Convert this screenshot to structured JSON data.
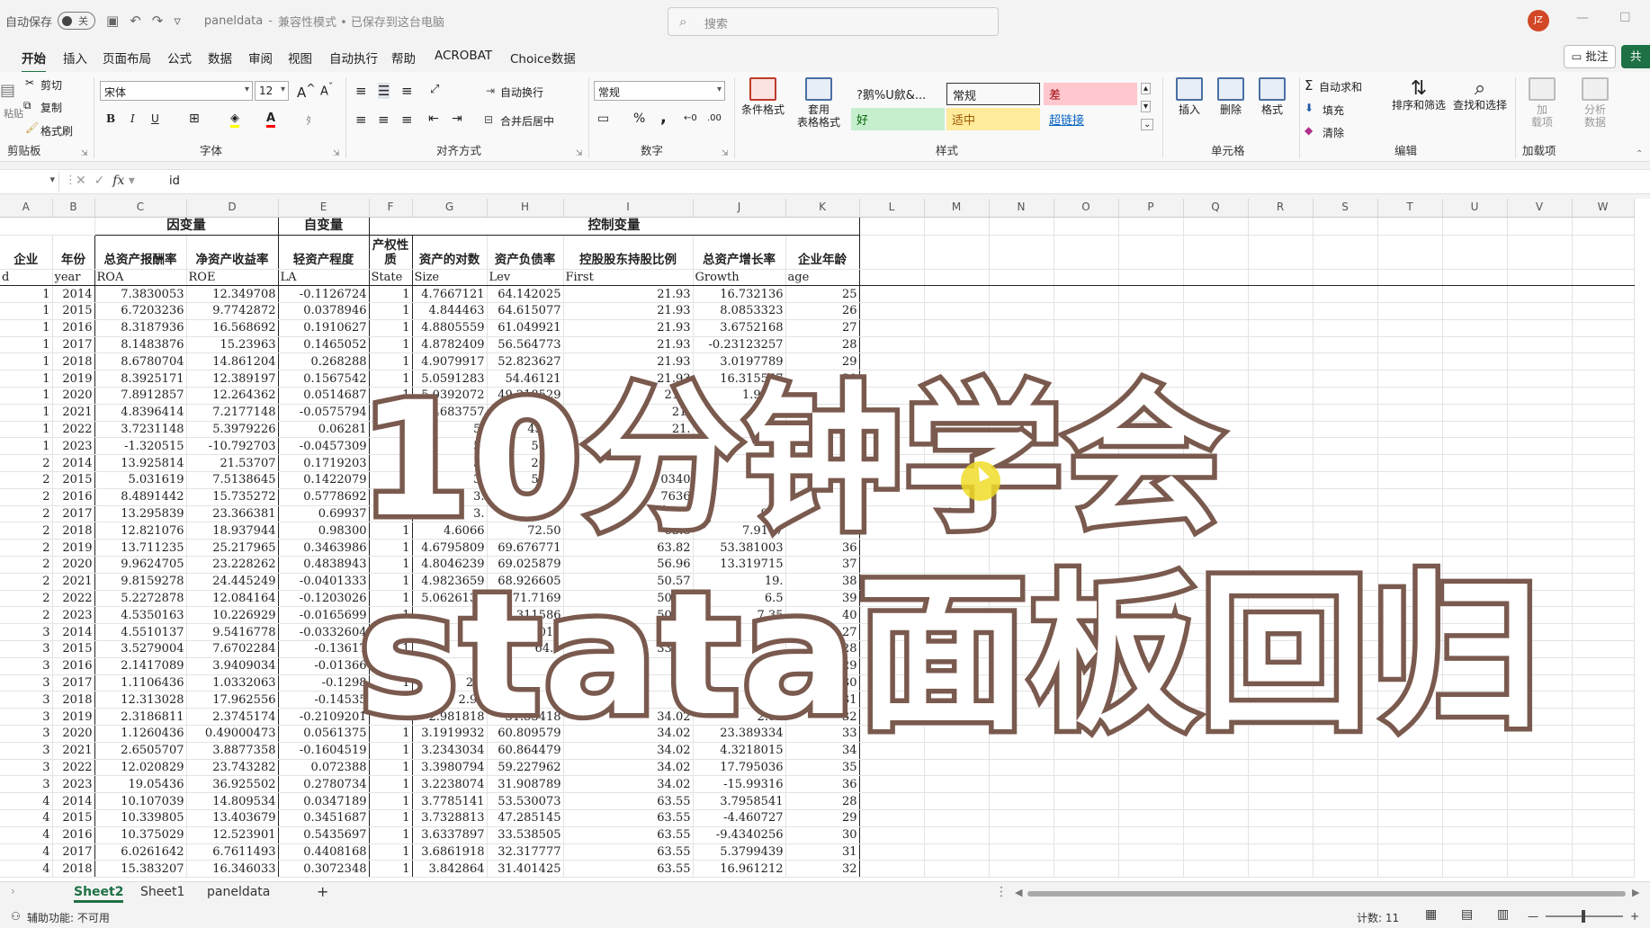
{
  "titlebar": {
    "autosave_label": "自动保存",
    "autosave_state": "关",
    "undo_icon": "undo-icon",
    "redo_icon": "redo-icon",
    "filename": "paneldata",
    "status": "兼容性模式 • 已保存到这台电脑",
    "search_placeholder": "搜索",
    "user_initials": "JZ"
  },
  "menu": {
    "tabs": [
      "开始",
      "插入",
      "页面布局",
      "公式",
      "数据",
      "审阅",
      "视图",
      "自动执行",
      "帮助",
      "ACROBAT",
      "Choice数据"
    ],
    "active": "开始",
    "comment_button": "批注",
    "share_button": "共"
  },
  "ribbon": {
    "clipboard": {
      "group": "剪贴板",
      "paste": "粘贴",
      "cut": "剪切",
      "copy": "复制",
      "format_painter": "格式刷"
    },
    "font": {
      "group": "字体",
      "font_name": "宋体",
      "font_size": "12",
      "bold": "B",
      "italic": "I",
      "underline": "U",
      "font_color": "A"
    },
    "alignment": {
      "group": "对齐方式",
      "wrap_text": "自动换行",
      "merge_center": "合并后居中"
    },
    "number": {
      "group": "数字",
      "format": "常规",
      "percent": "%",
      "comma": ","
    },
    "styles": {
      "group": "样式",
      "conditional_format": "条件格式",
      "table_format": "套用\n表格格式",
      "cells": [
        {
          "label": "?鹅%U歛&...",
          "bg": "#ffffff",
          "color": "#000000"
        },
        {
          "label": "常规",
          "bg": "#ffffff",
          "color": "#000000"
        },
        {
          "label": "差",
          "bg": "#ffc7ce",
          "color": "#9c0006"
        },
        {
          "label": "好",
          "bg": "#c6efce",
          "color": "#006100"
        },
        {
          "label": "适中",
          "bg": "#ffeb9c",
          "color": "#9c5700"
        },
        {
          "label": "超链接",
          "bg": "#ffffff",
          "color": "#0563c1"
        }
      ]
    },
    "cells": {
      "group": "单元格",
      "insert": "插入",
      "delete": "删除",
      "format": "格式"
    },
    "editing": {
      "group": "编辑",
      "autosum": "自动求和",
      "fill": "填充",
      "clear": "清除",
      "sort_filter": "排序和筛选",
      "find_select": "查找和选择"
    },
    "addins": {
      "group": "加载项",
      "addins": "加\n载项",
      "analyze": "分析\n数据"
    }
  },
  "formula_bar": {
    "name_box": "",
    "fx": "fx",
    "content": "id"
  },
  "columns": [
    "A",
    "B",
    "C",
    "D",
    "E",
    "F",
    "G",
    "H",
    "I",
    "J",
    "K",
    "L",
    "M",
    "N",
    "O",
    "P",
    "Q",
    "R",
    "S",
    "T",
    "U",
    "V",
    "W"
  ],
  "sheet": {
    "group_headers": {
      "dependent": "因变量",
      "independent": "自变量",
      "control": "控制变量"
    },
    "headers": [
      "企业",
      "年份",
      "总资产报酬率",
      "净资产收益率",
      "轻资产程度",
      "产权性质",
      "资产的对数",
      "资产负债率",
      "控股股东持股比例",
      "总资产增长率",
      "企业年龄"
    ],
    "var_names": [
      "d",
      "year",
      "ROA",
      "ROE",
      "LA",
      "State",
      "Size",
      "Lev",
      "First",
      "Growth",
      "age"
    ],
    "rows": [
      [
        "1",
        "2014",
        "7.3830053",
        "12.349708",
        "-0.1126724",
        "1",
        "4.7667121",
        "64.142025",
        "21.93",
        "16.732136",
        "25"
      ],
      [
        "1",
        "2015",
        "6.7203236",
        "9.7742872",
        "0.0378946",
        "1",
        "4.844463",
        "64.615077",
        "21.93",
        "8.0853323",
        "26"
      ],
      [
        "1",
        "2016",
        "8.3187936",
        "16.568692",
        "0.1910627",
        "1",
        "4.8805559",
        "61.049921",
        "21.93",
        "3.6752168",
        "27"
      ],
      [
        "1",
        "2017",
        "8.1483876",
        "15.23963",
        "0.1465052",
        "1",
        "4.8782409",
        "56.564773",
        "21.93",
        "-0.23123257",
        "28"
      ],
      [
        "1",
        "2018",
        "8.6780704",
        "14.861204",
        "0.268288",
        "1",
        "4.9079917",
        "52.823627",
        "21.93",
        "3.0197789",
        "29"
      ],
      [
        "1",
        "2019",
        "8.3925171",
        "12.389197",
        "0.1567542",
        "1",
        "5.0591283",
        "54.46121",
        "21.93",
        "16.315557",
        "30"
      ],
      [
        "1",
        "2020",
        "7.8912857",
        "12.264362",
        "0.0514687",
        "1",
        "5.0392072",
        "49.218529",
        "21.9",
        "1.9724",
        "31"
      ],
      [
        "1",
        "2021",
        "4.8396414",
        "7.2177148",
        "-0.0575794",
        "1",
        "5.4683757",
        "45.3219",
        "21.",
        "",
        "32"
      ],
      [
        "1",
        "2022",
        "3.7231148",
        "5.3979226",
        "0.06281",
        "1",
        "5.",
        "43.91",
        "21.",
        "",
        "33"
      ],
      [
        "1",
        "2023",
        "-1.320515",
        "-10.792703",
        "-0.0457309",
        "1",
        "5.",
        "5679",
        "",
        "",
        "34"
      ],
      [
        "2",
        "2014",
        "13.925814",
        "21.53707",
        "0.1719203",
        "1",
        "3.",
        "2673",
        "",
        "",
        "31"
      ],
      [
        "2",
        "2015",
        "5.031619",
        "7.5138645",
        "0.1422079",
        "1",
        "3.",
        "5798",
        "0340",
        "",
        "32"
      ],
      [
        "2",
        "2016",
        "8.4891442",
        "15.735272",
        "0.5778692",
        "1",
        "3.",
        "6568",
        "7636",
        "",
        "33"
      ],
      [
        "2",
        "2017",
        "13.295839",
        "23.366381",
        "0.69937",
        "1",
        "3.",
        "",
        "311",
        "950",
        "34"
      ],
      [
        "2",
        "2018",
        "12.821076",
        "18.937944",
        "0.98300",
        "1",
        "4.6066",
        "72.50",
        "63.8",
        "7.9147",
        "35"
      ],
      [
        "2",
        "2019",
        "13.711235",
        "25.217965",
        "0.3463986",
        "1",
        "4.6795809",
        "69.676771",
        "63.82",
        "53.381003",
        "36"
      ],
      [
        "2",
        "2020",
        "9.9624705",
        "23.228262",
        "0.4838943",
        "1",
        "4.8046239",
        "69.025879",
        "56.96",
        "13.319715",
        "37"
      ],
      [
        "2",
        "2021",
        "9.8159278",
        "24.445249",
        "-0.0401333",
        "1",
        "4.9823659",
        "68.926605",
        "50.57",
        "19.",
        "38"
      ],
      [
        "2",
        "2022",
        "5.2272878",
        "12.084164",
        "-0.1203026",
        "1",
        "5.0626132",
        "71.7169",
        "50.57",
        "6.5",
        "39"
      ],
      [
        "2",
        "2023",
        "4.5350163",
        "10.226929",
        "-0.0165699",
        "1",
        "5.",
        "72.311586",
        "50.57",
        "7.35",
        "40"
      ],
      [
        "3",
        "2014",
        "4.5510137",
        "9.5416778",
        "-0.0332604",
        "1",
        "3.",
        "67.66011",
        "33.03",
        "18.1",
        "27"
      ],
      [
        "3",
        "2015",
        "3.5279004",
        "7.6702284",
        "-0.13617",
        "1",
        "3.",
        "64.9",
        "33.92",
        "",
        "28"
      ],
      [
        "3",
        "2016",
        "2.1417089",
        "3.9409034",
        "-0.01366",
        "1",
        "2.",
        "",
        "",
        "",
        "29"
      ],
      [
        "3",
        "2017",
        "1.1106436",
        "1.0332063",
        "-0.1298",
        "1",
        "2.7",
        "",
        "",
        "",
        "30"
      ],
      [
        "3",
        "2018",
        "12.313028",
        "17.962556",
        "-0.14535",
        "1",
        "2.95",
        "",
        "",
        "",
        "31"
      ],
      [
        "3",
        "2019",
        "2.3186811",
        "2.3745174",
        "-0.2109201",
        "1",
        "2.981818",
        "31.53418",
        "34.02",
        "2.87",
        "32"
      ],
      [
        "3",
        "2020",
        "1.1260436",
        "0.49000473",
        "0.0561375",
        "1",
        "3.1919932",
        "60.809579",
        "34.02",
        "23.389334",
        "33"
      ],
      [
        "3",
        "2021",
        "2.6505707",
        "3.8877358",
        "-0.1604519",
        "1",
        "3.2343034",
        "60.864479",
        "34.02",
        "4.3218015",
        "34"
      ],
      [
        "3",
        "2022",
        "12.020829",
        "23.743282",
        "0.072388",
        "1",
        "3.3980794",
        "59.227962",
        "34.02",
        "17.795036",
        "35"
      ],
      [
        "3",
        "2023",
        "19.05436",
        "36.925502",
        "0.2780734",
        "1",
        "3.2238074",
        "31.908789",
        "34.02",
        "-15.99316",
        "36"
      ],
      [
        "4",
        "2014",
        "10.107039",
        "14.809534",
        "0.0347189",
        "1",
        "3.7785141",
        "53.530073",
        "63.55",
        "3.7958541",
        "28"
      ],
      [
        "4",
        "2015",
        "10.339805",
        "13.403679",
        "0.3451687",
        "1",
        "3.7328813",
        "47.285145",
        "63.55",
        "-4.460727",
        "29"
      ],
      [
        "4",
        "2016",
        "10.375029",
        "12.523901",
        "0.5435697",
        "1",
        "3.6337897",
        "33.538505",
        "63.55",
        "-9.4340256",
        "30"
      ],
      [
        "4",
        "2017",
        "6.0261642",
        "6.7611493",
        "0.4408168",
        "1",
        "3.6861918",
        "32.317777",
        "63.55",
        "5.3799439",
        "31"
      ],
      [
        "4",
        "2018",
        "15.383207",
        "16.346033",
        "0.3072348",
        "1",
        "3.842864",
        "31.401425",
        "63.55",
        "16.961212",
        "32"
      ]
    ]
  },
  "overlay": {
    "line1": "10分钟学会",
    "line2": "stata面板回归"
  },
  "sheet_tabs": [
    "Sheet2",
    "Sheet1",
    "paneldata"
  ],
  "active_sheet": "Sheet2",
  "add_sheet": "+",
  "status": {
    "accessibility": "辅助功能: 不可用",
    "count": "计数: 11"
  },
  "colors": {
    "accent": "#1e7145",
    "overlay_stroke": "#7a5a4e"
  }
}
